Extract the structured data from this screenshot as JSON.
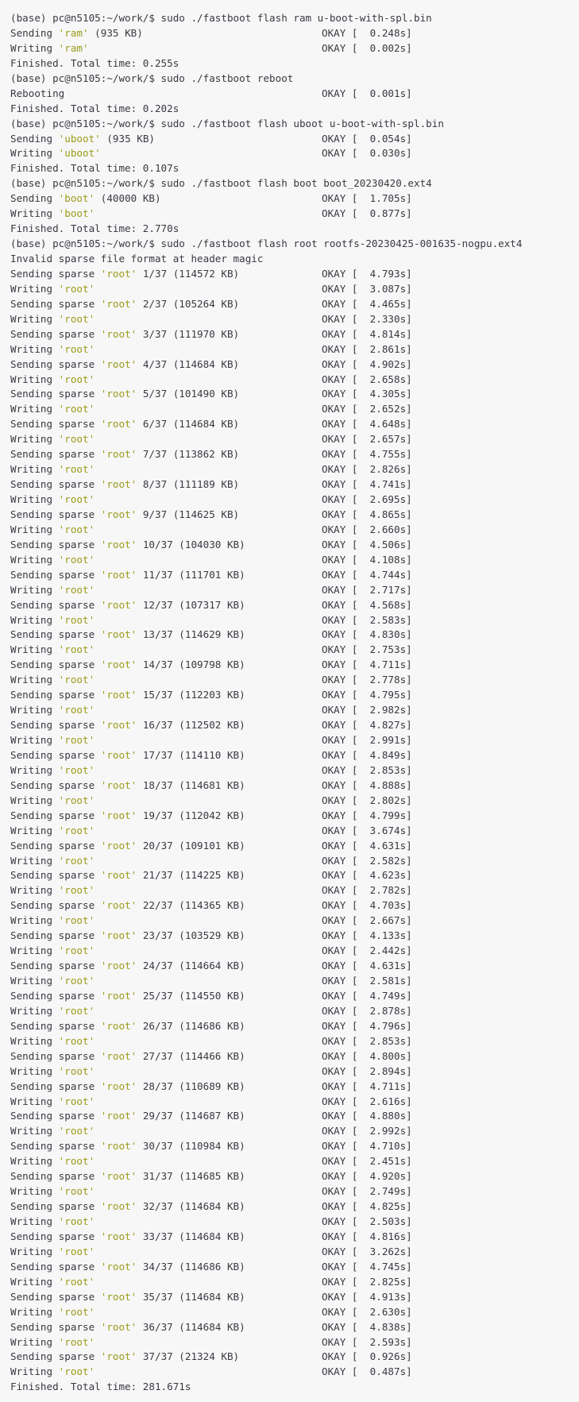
{
  "terminal": {
    "lines": [
      {
        "text": "(base) pc@n5105:~/work/$ sudo ./fastboot flash ram u-boot-with-spl.bin"
      },
      {
        "pre": "Sending ",
        "q": "'ram'",
        "post": " (935 KB)",
        "status": "OKAY [  0.248s]"
      },
      {
        "pre": "Writing ",
        "q": "'ram'",
        "post": "",
        "status": "OKAY [  0.002s]"
      },
      {
        "text": "Finished. Total time: 0.255s"
      },
      {
        "text": "(base) pc@n5105:~/work/$ sudo ./fastboot reboot"
      },
      {
        "pre": "Rebooting",
        "q": "",
        "post": "",
        "status": "OKAY [  0.001s]"
      },
      {
        "text": "Finished. Total time: 0.202s"
      },
      {
        "text": "(base) pc@n5105:~/work/$ sudo ./fastboot flash uboot u-boot-with-spl.bin"
      },
      {
        "pre": "Sending ",
        "q": "'uboot'",
        "post": " (935 KB)",
        "status": "OKAY [  0.054s]"
      },
      {
        "pre": "Writing ",
        "q": "'uboot'",
        "post": "",
        "status": "OKAY [  0.030s]"
      },
      {
        "text": "Finished. Total time: 0.107s"
      },
      {
        "text": "(base) pc@n5105:~/work/$ sudo ./fastboot flash boot boot_20230420.ext4"
      },
      {
        "pre": "Sending ",
        "q": "'boot'",
        "post": " (40000 KB)",
        "status": "OKAY [  1.705s]"
      },
      {
        "pre": "Writing ",
        "q": "'boot'",
        "post": "",
        "status": "OKAY [  0.877s]"
      },
      {
        "text": "Finished. Total time: 2.770s"
      },
      {
        "text": "(base) pc@n5105:~/work/$ sudo ./fastboot flash root rootfs-20230425-001635-nogpu.ext4"
      },
      {
        "text": "Invalid sparse file format at header magic"
      },
      {
        "pre": "Sending sparse ",
        "q": "'root'",
        "post": " 1/37 (114572 KB)",
        "status": "OKAY [  4.793s]"
      },
      {
        "pre": "Writing ",
        "q": "'root'",
        "post": "",
        "status": "OKAY [  3.087s]"
      },
      {
        "pre": "Sending sparse ",
        "q": "'root'",
        "post": " 2/37 (105264 KB)",
        "status": "OKAY [  4.465s]"
      },
      {
        "pre": "Writing ",
        "q": "'root'",
        "post": "",
        "status": "OKAY [  2.330s]"
      },
      {
        "pre": "Sending sparse ",
        "q": "'root'",
        "post": " 3/37 (111970 KB)",
        "status": "OKAY [  4.814s]"
      },
      {
        "pre": "Writing ",
        "q": "'root'",
        "post": "",
        "status": "OKAY [  2.861s]"
      },
      {
        "pre": "Sending sparse ",
        "q": "'root'",
        "post": " 4/37 (114684 KB)",
        "status": "OKAY [  4.902s]"
      },
      {
        "pre": "Writing ",
        "q": "'root'",
        "post": "",
        "status": "OKAY [  2.658s]"
      },
      {
        "pre": "Sending sparse ",
        "q": "'root'",
        "post": " 5/37 (101490 KB)",
        "status": "OKAY [  4.305s]"
      },
      {
        "pre": "Writing ",
        "q": "'root'",
        "post": "",
        "status": "OKAY [  2.652s]"
      },
      {
        "pre": "Sending sparse ",
        "q": "'root'",
        "post": " 6/37 (114684 KB)",
        "status": "OKAY [  4.648s]"
      },
      {
        "pre": "Writing ",
        "q": "'root'",
        "post": "",
        "status": "OKAY [  2.657s]"
      },
      {
        "pre": "Sending sparse ",
        "q": "'root'",
        "post": " 7/37 (113862 KB)",
        "status": "OKAY [  4.755s]"
      },
      {
        "pre": "Writing ",
        "q": "'root'",
        "post": "",
        "status": "OKAY [  2.826s]"
      },
      {
        "pre": "Sending sparse ",
        "q": "'root'",
        "post": " 8/37 (111189 KB)",
        "status": "OKAY [  4.741s]"
      },
      {
        "pre": "Writing ",
        "q": "'root'",
        "post": "",
        "status": "OKAY [  2.695s]"
      },
      {
        "pre": "Sending sparse ",
        "q": "'root'",
        "post": " 9/37 (114625 KB)",
        "status": "OKAY [  4.865s]"
      },
      {
        "pre": "Writing ",
        "q": "'root'",
        "post": "",
        "status": "OKAY [  2.660s]"
      },
      {
        "pre": "Sending sparse ",
        "q": "'root'",
        "post": " 10/37 (104030 KB)",
        "status": "OKAY [  4.506s]"
      },
      {
        "pre": "Writing ",
        "q": "'root'",
        "post": "",
        "status": "OKAY [  4.108s]"
      },
      {
        "pre": "Sending sparse ",
        "q": "'root'",
        "post": " 11/37 (111701 KB)",
        "status": "OKAY [  4.744s]"
      },
      {
        "pre": "Writing ",
        "q": "'root'",
        "post": "",
        "status": "OKAY [  2.717s]"
      },
      {
        "pre": "Sending sparse ",
        "q": "'root'",
        "post": " 12/37 (107317 KB)",
        "status": "OKAY [  4.568s]"
      },
      {
        "pre": "Writing ",
        "q": "'root'",
        "post": "",
        "status": "OKAY [  2.583s]"
      },
      {
        "pre": "Sending sparse ",
        "q": "'root'",
        "post": " 13/37 (114629 KB)",
        "status": "OKAY [  4.830s]"
      },
      {
        "pre": "Writing ",
        "q": "'root'",
        "post": "",
        "status": "OKAY [  2.753s]"
      },
      {
        "pre": "Sending sparse ",
        "q": "'root'",
        "post": " 14/37 (109798 KB)",
        "status": "OKAY [  4.711s]"
      },
      {
        "pre": "Writing ",
        "q": "'root'",
        "post": "",
        "status": "OKAY [  2.778s]"
      },
      {
        "pre": "Sending sparse ",
        "q": "'root'",
        "post": " 15/37 (112203 KB)",
        "status": "OKAY [  4.795s]"
      },
      {
        "pre": "Writing ",
        "q": "'root'",
        "post": "",
        "status": "OKAY [  2.982s]"
      },
      {
        "pre": "Sending sparse ",
        "q": "'root'",
        "post": " 16/37 (112502 KB)",
        "status": "OKAY [  4.827s]"
      },
      {
        "pre": "Writing ",
        "q": "'root'",
        "post": "",
        "status": "OKAY [  2.991s]"
      },
      {
        "pre": "Sending sparse ",
        "q": "'root'",
        "post": " 17/37 (114110 KB)",
        "status": "OKAY [  4.849s]"
      },
      {
        "pre": "Writing ",
        "q": "'root'",
        "post": "",
        "status": "OKAY [  2.853s]"
      },
      {
        "pre": "Sending sparse ",
        "q": "'root'",
        "post": " 18/37 (114681 KB)",
        "status": "OKAY [  4.888s]"
      },
      {
        "pre": "Writing ",
        "q": "'root'",
        "post": "",
        "status": "OKAY [  2.802s]"
      },
      {
        "pre": "Sending sparse ",
        "q": "'root'",
        "post": " 19/37 (112042 KB)",
        "status": "OKAY [  4.799s]"
      },
      {
        "pre": "Writing ",
        "q": "'root'",
        "post": "",
        "status": "OKAY [  3.674s]"
      },
      {
        "pre": "Sending sparse ",
        "q": "'root'",
        "post": " 20/37 (109101 KB)",
        "status": "OKAY [  4.631s]"
      },
      {
        "pre": "Writing ",
        "q": "'root'",
        "post": "",
        "status": "OKAY [  2.582s]"
      },
      {
        "pre": "Sending sparse ",
        "q": "'root'",
        "post": " 21/37 (114225 KB)",
        "status": "OKAY [  4.623s]"
      },
      {
        "pre": "Writing ",
        "q": "'root'",
        "post": "",
        "status": "OKAY [  2.782s]"
      },
      {
        "pre": "Sending sparse ",
        "q": "'root'",
        "post": " 22/37 (114365 KB)",
        "status": "OKAY [  4.703s]"
      },
      {
        "pre": "Writing ",
        "q": "'root'",
        "post": "",
        "status": "OKAY [  2.667s]"
      },
      {
        "pre": "Sending sparse ",
        "q": "'root'",
        "post": " 23/37 (103529 KB)",
        "status": "OKAY [  4.133s]"
      },
      {
        "pre": "Writing ",
        "q": "'root'",
        "post": "",
        "status": "OKAY [  2.442s]"
      },
      {
        "pre": "Sending sparse ",
        "q": "'root'",
        "post": " 24/37 (114664 KB)",
        "status": "OKAY [  4.631s]"
      },
      {
        "pre": "Writing ",
        "q": "'root'",
        "post": "",
        "status": "OKAY [  2.581s]"
      },
      {
        "pre": "Sending sparse ",
        "q": "'root'",
        "post": " 25/37 (114550 KB)",
        "status": "OKAY [  4.749s]"
      },
      {
        "pre": "Writing ",
        "q": "'root'",
        "post": "",
        "status": "OKAY [  2.878s]"
      },
      {
        "pre": "Sending sparse ",
        "q": "'root'",
        "post": " 26/37 (114686 KB)",
        "status": "OKAY [  4.796s]"
      },
      {
        "pre": "Writing ",
        "q": "'root'",
        "post": "",
        "status": "OKAY [  2.853s]"
      },
      {
        "pre": "Sending sparse ",
        "q": "'root'",
        "post": " 27/37 (114466 KB)",
        "status": "OKAY [  4.800s]"
      },
      {
        "pre": "Writing ",
        "q": "'root'",
        "post": "",
        "status": "OKAY [  2.894s]"
      },
      {
        "pre": "Sending sparse ",
        "q": "'root'",
        "post": " 28/37 (110689 KB)",
        "status": "OKAY [  4.711s]"
      },
      {
        "pre": "Writing ",
        "q": "'root'",
        "post": "",
        "status": "OKAY [  2.616s]"
      },
      {
        "pre": "Sending sparse ",
        "q": "'root'",
        "post": " 29/37 (114687 KB)",
        "status": "OKAY [  4.880s]"
      },
      {
        "pre": "Writing ",
        "q": "'root'",
        "post": "",
        "status": "OKAY [  2.992s]"
      },
      {
        "pre": "Sending sparse ",
        "q": "'root'",
        "post": " 30/37 (110984 KB)",
        "status": "OKAY [  4.710s]"
      },
      {
        "pre": "Writing ",
        "q": "'root'",
        "post": "",
        "status": "OKAY [  2.451s]"
      },
      {
        "pre": "Sending sparse ",
        "q": "'root'",
        "post": " 31/37 (114685 KB)",
        "status": "OKAY [  4.920s]"
      },
      {
        "pre": "Writing ",
        "q": "'root'",
        "post": "",
        "status": "OKAY [  2.749s]"
      },
      {
        "pre": "Sending sparse ",
        "q": "'root'",
        "post": " 32/37 (114684 KB)",
        "status": "OKAY [  4.825s]"
      },
      {
        "pre": "Writing ",
        "q": "'root'",
        "post": "",
        "status": "OKAY [  2.503s]"
      },
      {
        "pre": "Sending sparse ",
        "q": "'root'",
        "post": " 33/37 (114684 KB)",
        "status": "OKAY [  4.816s]"
      },
      {
        "pre": "Writing ",
        "q": "'root'",
        "post": "",
        "status": "OKAY [  3.262s]"
      },
      {
        "pre": "Sending sparse ",
        "q": "'root'",
        "post": " 34/37 (114686 KB)",
        "status": "OKAY [  4.745s]"
      },
      {
        "pre": "Writing ",
        "q": "'root'",
        "post": "",
        "status": "OKAY [  2.825s]"
      },
      {
        "pre": "Sending sparse ",
        "q": "'root'",
        "post": " 35/37 (114684 KB)",
        "status": "OKAY [  4.913s]"
      },
      {
        "pre": "Writing ",
        "q": "'root'",
        "post": "",
        "status": "OKAY [  2.630s]"
      },
      {
        "pre": "Sending sparse ",
        "q": "'root'",
        "post": " 36/37 (114684 KB)",
        "status": "OKAY [  4.838s]"
      },
      {
        "pre": "Writing ",
        "q": "'root'",
        "post": "",
        "status": "OKAY [  2.593s]"
      },
      {
        "pre": "Sending sparse ",
        "q": "'root'",
        "post": " 37/37 (21324 KB)",
        "status": "OKAY [  0.926s]"
      },
      {
        "pre": "Writing ",
        "q": "'root'",
        "post": "",
        "status": "OKAY [  0.487s]"
      },
      {
        "text": "Finished. Total time: 281.671s"
      }
    ]
  }
}
